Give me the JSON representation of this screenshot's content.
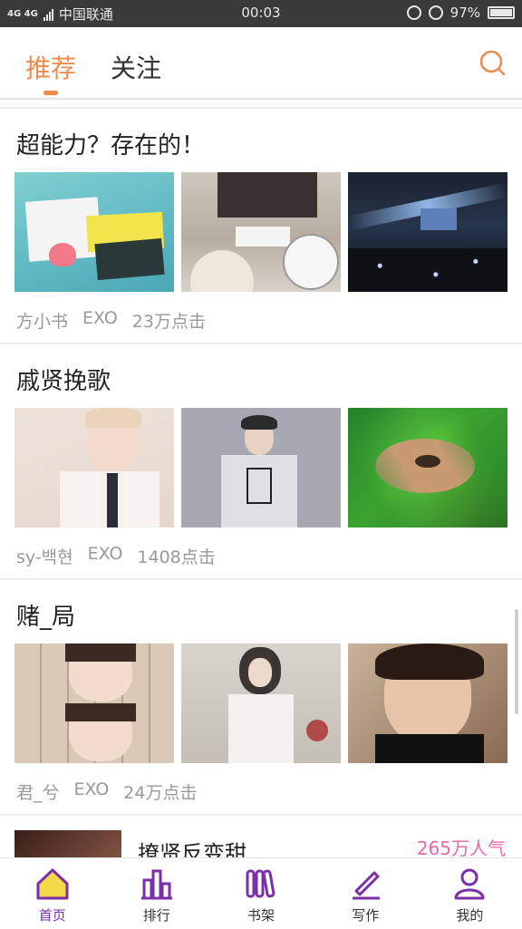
{
  "status_bar": {
    "network": "4G 4G",
    "carrier": "中国联通",
    "time": "00:03",
    "battery": "97%"
  },
  "header": {
    "tabs": [
      {
        "label": "推荐",
        "active": true
      },
      {
        "label": "关注",
        "active": false
      }
    ],
    "accent_color": "#f08a4b",
    "search_icon": "search-icon"
  },
  "feed": [
    {
      "title": "超能力？存在的！",
      "author": "方小书",
      "category": "EXO",
      "clicks": "23万点击"
    },
    {
      "title": "戚贤挽歌",
      "author": "sy-백현",
      "category": "EXO",
      "clicks": "1408点击"
    },
    {
      "title": "赌_局",
      "author": "君_兮",
      "category": "EXO",
      "clicks": "24万点击"
    }
  ],
  "partial_item": {
    "title": "撩贤反变甜",
    "popularity": "265万人气",
    "popularity_color": "#e86aa8"
  },
  "bottom_nav": [
    {
      "label": "首页",
      "icon": "home-icon",
      "active": true
    },
    {
      "label": "排行",
      "icon": "rank-icon",
      "active": false
    },
    {
      "label": "书架",
      "icon": "bookshelf-icon",
      "active": false
    },
    {
      "label": "写作",
      "icon": "pen-icon",
      "active": false
    },
    {
      "label": "我的",
      "icon": "profile-icon",
      "active": false
    }
  ],
  "nav_active_color": "#7a2fa8"
}
